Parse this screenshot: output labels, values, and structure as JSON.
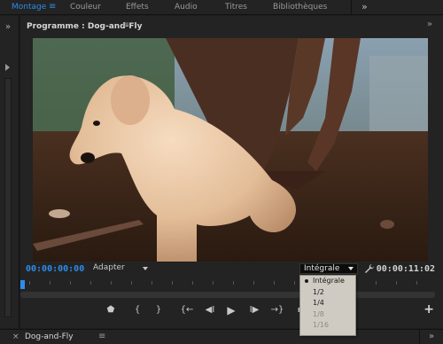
{
  "workspaces": [
    {
      "label": "Montage",
      "active": true
    },
    {
      "label": "Couleur",
      "active": false
    },
    {
      "label": "Effets",
      "active": false
    },
    {
      "label": "Audio",
      "active": false
    },
    {
      "label": "Titres",
      "active": false
    },
    {
      "label": "Bibliothèques",
      "active": false
    }
  ],
  "program": {
    "title": "Programme : Dog-and-Fly",
    "timecode_current": "00:00:00:00",
    "timecode_duration": "00:00:11:02",
    "fit_select": "Adapter",
    "resolution_select": "Intégrale",
    "resolution_options": [
      {
        "label": "Intégrale",
        "selected": true,
        "enabled": true
      },
      {
        "label": "1/2",
        "selected": false,
        "enabled": true
      },
      {
        "label": "1/4",
        "selected": false,
        "enabled": true
      },
      {
        "label": "1/8",
        "selected": false,
        "enabled": false
      },
      {
        "label": "1/16",
        "selected": false,
        "enabled": false
      }
    ]
  },
  "transport": {
    "buttons": [
      "add-marker",
      "mark-in",
      "mark-out",
      "go-to-in",
      "step-back",
      "play",
      "step-forward",
      "go-to-out",
      "lift"
    ],
    "add_label": "+"
  },
  "timeline_tab": {
    "name": "Dog-and-Fly"
  },
  "colors": {
    "accent": "#2d8ceb",
    "panel_bg": "#232323",
    "popup_bg": "#cfcac2"
  }
}
